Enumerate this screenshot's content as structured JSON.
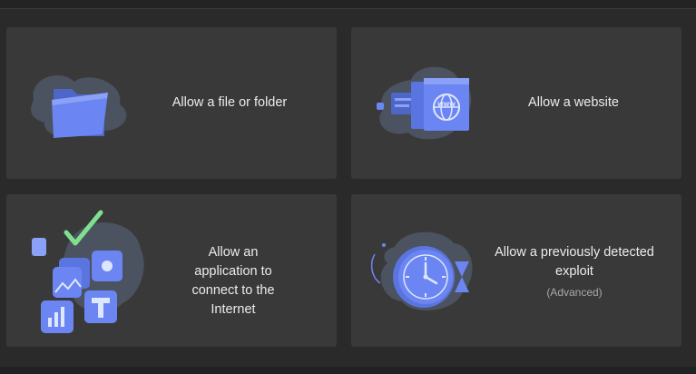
{
  "colors": {
    "background": "#2a2a2a",
    "card": "#393939",
    "illustration_blob": "#4b5260",
    "accent_blue": "#6b86f2",
    "accent_green": "#7fe08f"
  },
  "cards": [
    {
      "label": "Allow a file or folder",
      "icon": "folder-icon"
    },
    {
      "label": "Allow a website",
      "icon": "browser-www-icon"
    },
    {
      "label": "Allow an application to connect to the Internet",
      "icon": "application-grid-icon"
    },
    {
      "label": "Allow a previously detected exploit",
      "sublabel": "(Advanced)",
      "icon": "clock-icon"
    }
  ]
}
